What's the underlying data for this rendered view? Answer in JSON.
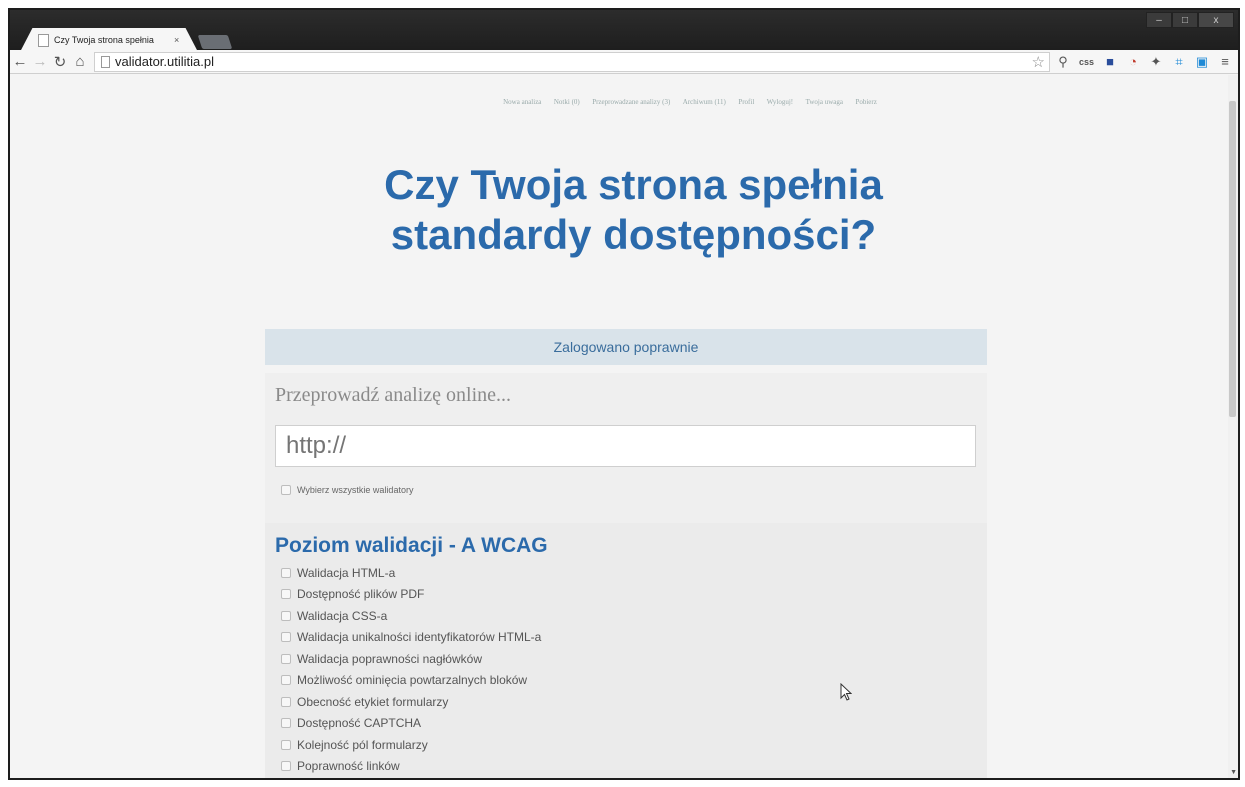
{
  "browser": {
    "tab_title": "Czy Twoja strona spełnia",
    "tab_close": "×",
    "url": "validator.utilitia.pl",
    "window_controls": [
      "–",
      "□",
      "x"
    ],
    "extensions": [
      "css"
    ]
  },
  "nav": {
    "items": [
      "Nowa analiza",
      "Notki (0)",
      "Przeprowadzane analizy (3)",
      "Archiwum (11)",
      "Profil",
      "Wyloguj!",
      "Twoja uwaga",
      "Pobierz"
    ]
  },
  "headline": {
    "line1": "Czy Twoja strona spełnia",
    "line2": "standardy dostępności?"
  },
  "alert": {
    "text": "Zalogowano poprawnie"
  },
  "form": {
    "title": "Przeprowadź analizę online...",
    "url_placeholder": "http://",
    "select_all_label": "Wybierz wszystkie walidatory"
  },
  "level": {
    "title": "Poziom walidacji - A WCAG",
    "items": [
      "Walidacja HTML-a",
      "Dostępność plików PDF",
      "Walidacja CSS-a",
      "Walidacja unikalności identyfikatorów HTML-a",
      "Walidacja poprawności nagłówków",
      "Możliwość ominięcia powtarzalnych bloków",
      "Obecność etykiet formularzy",
      "Dostępność CAPTCHA",
      "Kolejność pól formularzy",
      "Poprawność linków"
    ]
  },
  "colors": {
    "accent": "#2b6aab",
    "alert_bg": "#d9e3ea",
    "chrome_dark": "#1e1e1e"
  }
}
